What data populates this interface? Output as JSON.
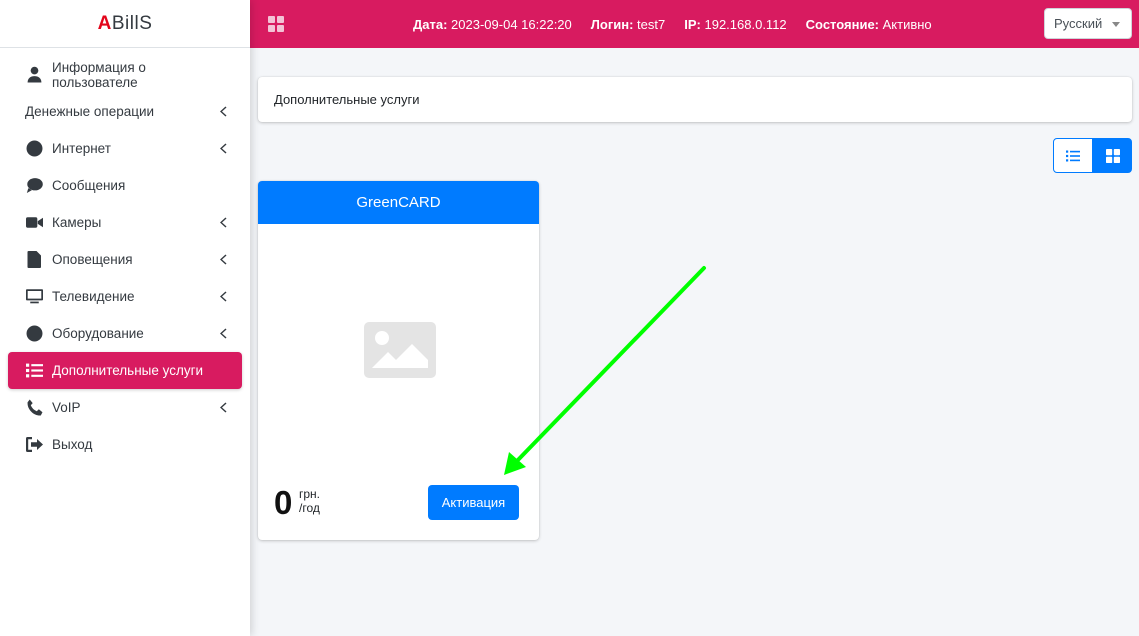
{
  "brand": {
    "accent_letter": "A",
    "rest": "BillS"
  },
  "sidebar": {
    "items": [
      {
        "label": "Информация о пользователе",
        "icon": "user-icon",
        "chevron": false
      },
      {
        "label": "Денежные операции",
        "icon": "",
        "chevron": true
      },
      {
        "label": "Интернет",
        "icon": "globe-icon",
        "chevron": true
      },
      {
        "label": "Сообщения",
        "icon": "comment-icon",
        "chevron": false
      },
      {
        "label": "Камеры",
        "icon": "video-camera-icon",
        "chevron": true
      },
      {
        "label": "Оповещения",
        "icon": "file-icon",
        "chevron": true
      },
      {
        "label": "Телевидение",
        "icon": "tv-icon",
        "chevron": true
      },
      {
        "label": "Оборудование",
        "icon": "circle-icon",
        "chevron": true
      },
      {
        "label": "Дополнительные услуги",
        "icon": "list-icon",
        "chevron": false,
        "active": true
      },
      {
        "label": "VoIP",
        "icon": "phone-icon",
        "chevron": true
      },
      {
        "label": "Выход",
        "icon": "sign-out-icon",
        "chevron": false
      }
    ]
  },
  "topbar": {
    "date_label": "Дата:",
    "date_value": "2023-09-04 16:22:20",
    "login_label": "Логин:",
    "login_value": "test7",
    "ip_label": "IP:",
    "ip_value": "192.168.0.112",
    "state_label": "Состояние:",
    "state_value": "Активно",
    "language": "Русский"
  },
  "main": {
    "breadcrumb": "Дополнительные услуги",
    "card": {
      "title": "GreenCARD",
      "price": "0",
      "currency": "грн.",
      "period": "/год",
      "button": "Активация"
    }
  },
  "colors": {
    "accent": "#d81b60",
    "primary": "#007bff",
    "annotation_arrow": "#00ff00"
  }
}
